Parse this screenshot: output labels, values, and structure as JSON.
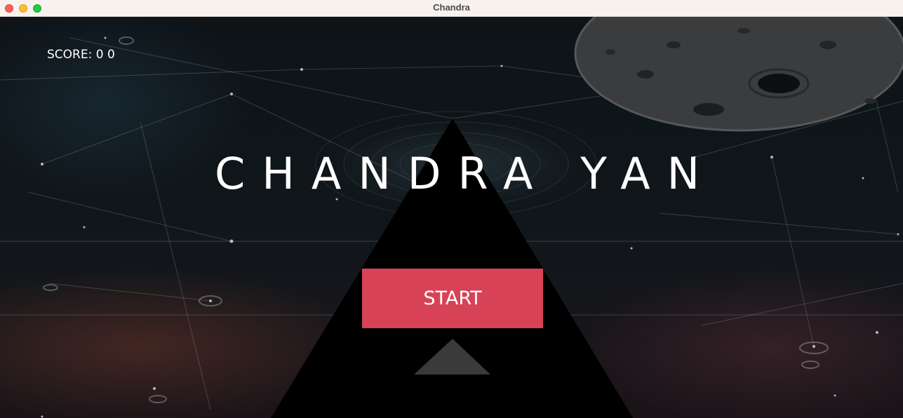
{
  "window": {
    "title": "Chandra"
  },
  "game": {
    "score_label": "SCORE: 0 0",
    "title": "CHANDRA YAN",
    "start_label": "START"
  },
  "colors": {
    "titlebar": "#f7f2ee",
    "start_button": "#d84256",
    "pyramid": "#000000",
    "arrow": "#3a3a3a",
    "text": "#ffffff"
  },
  "icons": {
    "close": "close-dot-icon",
    "minimize": "minimize-dot-icon",
    "maximize": "maximize-dot-icon",
    "arrow": "up-arrow-icon"
  }
}
